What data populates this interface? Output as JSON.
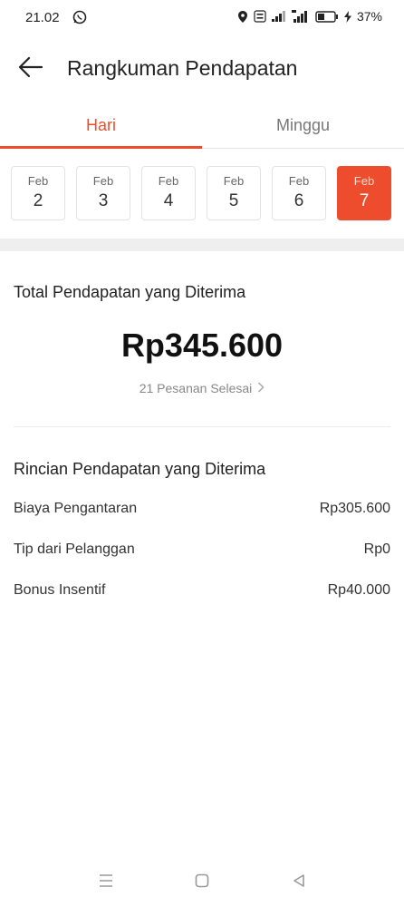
{
  "status_bar": {
    "time": "21.02",
    "battery": "37%",
    "icons": [
      "whatsapp-icon",
      "location-icon",
      "volte-icon",
      "signal-icon",
      "4g-signal-icon",
      "battery-icon",
      "charging-icon"
    ]
  },
  "header": {
    "title": "Rangkuman Pendapatan",
    "back_icon": "arrow-left-icon"
  },
  "tabs": [
    {
      "label": "Hari",
      "active": true
    },
    {
      "label": "Minggu",
      "active": false
    }
  ],
  "dates": [
    {
      "month": "Feb",
      "day": "2",
      "active": false
    },
    {
      "month": "Feb",
      "day": "3",
      "active": false
    },
    {
      "month": "Feb",
      "day": "4",
      "active": false
    },
    {
      "month": "Feb",
      "day": "5",
      "active": false
    },
    {
      "month": "Feb",
      "day": "6",
      "active": false
    },
    {
      "month": "Feb",
      "day": "7",
      "active": true
    }
  ],
  "summary": {
    "title": "Total Pendapatan yang Diterima",
    "amount": "Rp345.600",
    "orders_link": "21 Pesanan Selesai"
  },
  "details": {
    "title": "Rincian Pendapatan yang Diterima",
    "rows": [
      {
        "label": "Biaya Pengantaran",
        "value": "Rp305.600"
      },
      {
        "label": "Tip dari Pelanggan",
        "value": "Rp0"
      },
      {
        "label": "Bonus Insentif",
        "value": "Rp40.000"
      }
    ]
  },
  "colors": {
    "accent": "#ee4d2d",
    "divider": "#efefef",
    "text": "#222222",
    "muted": "#888888"
  }
}
